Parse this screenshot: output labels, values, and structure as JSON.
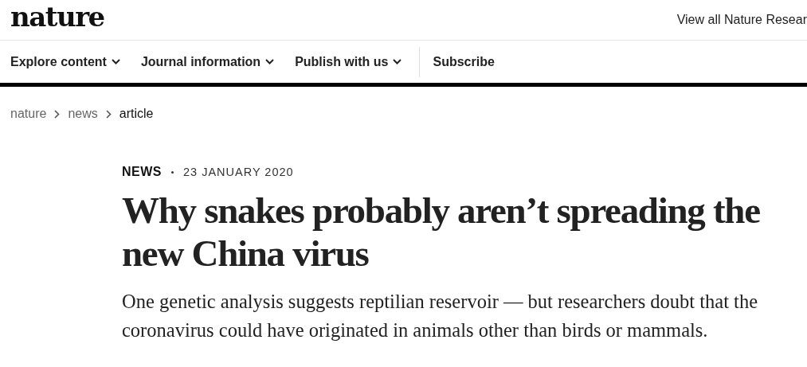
{
  "header": {
    "logo": "nature",
    "top_link": "View all Nature Resear"
  },
  "nav": [
    {
      "label": "Explore content",
      "kind": "dropdown"
    },
    {
      "label": "Journal information",
      "kind": "dropdown"
    },
    {
      "label": "Publish with us",
      "kind": "dropdown"
    },
    {
      "label": "Subscribe",
      "kind": "link"
    }
  ],
  "breadcrumbs": [
    {
      "label": "nature",
      "current": false
    },
    {
      "label": "news",
      "current": false
    },
    {
      "label": "article",
      "current": true
    }
  ],
  "article": {
    "type": "NEWS",
    "date": "23 JANUARY 2020",
    "title": "Why snakes probably aren’t spreading the new China virus",
    "standfirst": "One genetic analysis suggests reptilian reservoir — but researchers doubt that the coronavirus could have originated in animals other than birds or mammals."
  }
}
